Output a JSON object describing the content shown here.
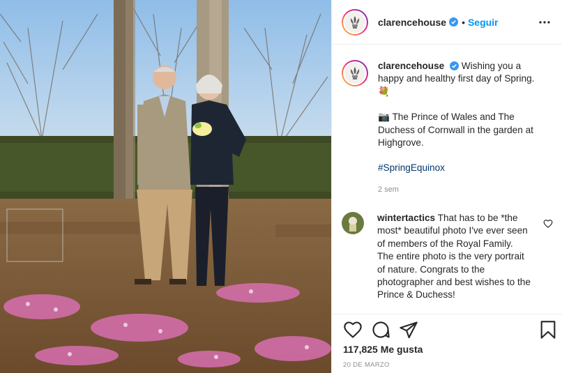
{
  "post": {
    "image_alt": "The Prince of Wales and The Duchess of Cornwall in the garden at Highgrove"
  },
  "header": {
    "username": "clarencehouse",
    "separator": "•",
    "follow_label": "Seguir",
    "verified_icon": "verified-badge-icon",
    "more_icon": "more-options-icon"
  },
  "caption": {
    "username": "clarencehouse",
    "line1": "Wishing you a happy and healthy first day of Spring.",
    "emoji": "💐",
    "line2": "📷 The Prince of Wales and The Duchess of Cornwall in the garden at Highgrove.",
    "hashtag": "#SpringEquinox",
    "age": "2 sem"
  },
  "comment": {
    "username": "wintertactics",
    "text": "That has to be *the most* beautiful photo I've ever seen of members of the Royal Family. The entire photo is the very portrait of nature. Congrats to the photographer and best wishes to the Prince & Duchess!"
  },
  "actions": {
    "icons": [
      "heart-icon",
      "comment-icon",
      "share-icon",
      "bookmark-icon"
    ],
    "likes": "117,825 Me gusta",
    "date": "20 DE MARZO"
  },
  "colors": {
    "accent": "#0095f6",
    "hashtag": "#00376b",
    "muted": "#8e8e8e",
    "text": "#262626",
    "border": "#efefef"
  }
}
